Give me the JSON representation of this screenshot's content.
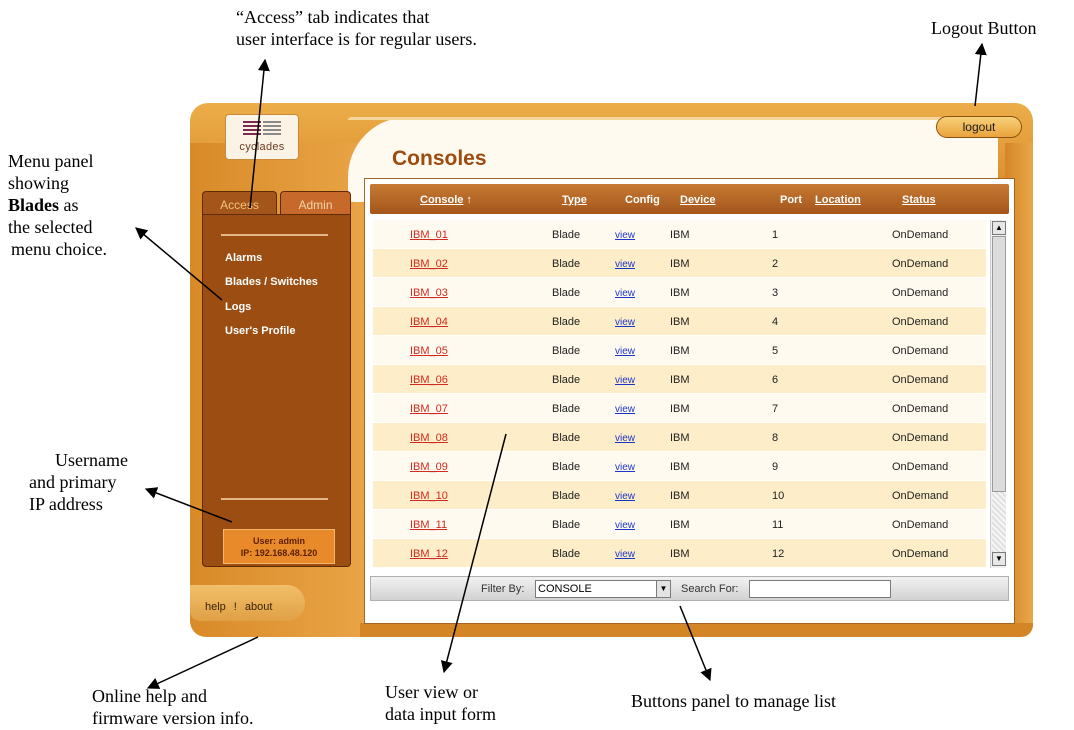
{
  "annotations": {
    "access_tab_note": [
      "“Access” tab indicates that",
      "user interface is for regular users."
    ],
    "logout_note": "Logout Button",
    "menu_note": {
      "line1": "Menu panel",
      "line2": "showing",
      "bold": "Blades",
      "line3_suffix": " as",
      "line4": "the selected",
      "line5": "menu choice."
    },
    "user_note": [
      "Username",
      "and primary",
      "IP address"
    ],
    "help_note": [
      "Online help and",
      "firmware version info."
    ],
    "form_note": [
      "User view or",
      "data input form"
    ],
    "buttons_note": "Buttons panel to manage list"
  },
  "app": {
    "logo_text": "cyclades",
    "logout_label": "logout",
    "page_title": "Consoles",
    "tabs": [
      {
        "label": "Access",
        "active": true
      },
      {
        "label": "Admin",
        "active": false
      }
    ],
    "menu_items": [
      "Alarms",
      "Blades / Switches",
      "Logs",
      "User's Profile"
    ],
    "user_line": "User: admin",
    "ip_line": "IP: 192.168.48.120",
    "help_label": "help",
    "help_separator": "!",
    "about_label": "about"
  },
  "table": {
    "columns": {
      "console": "Console",
      "type": "Type",
      "config": "Config",
      "device": "Device",
      "port": "Port",
      "location": "Location",
      "status": "Status"
    },
    "sort_icon": "↑",
    "rows": [
      {
        "console": "IBM_01",
        "type": "Blade",
        "config": "view",
        "device": "IBM",
        "port": "1",
        "location": "",
        "status": "OnDemand"
      },
      {
        "console": "IBM_02",
        "type": "Blade",
        "config": "view",
        "device": "IBM",
        "port": "2",
        "location": "",
        "status": "OnDemand"
      },
      {
        "console": "IBM_03",
        "type": "Blade",
        "config": "view",
        "device": "IBM",
        "port": "3",
        "location": "",
        "status": "OnDemand"
      },
      {
        "console": "IBM_04",
        "type": "Blade",
        "config": "view",
        "device": "IBM",
        "port": "4",
        "location": "",
        "status": "OnDemand"
      },
      {
        "console": "IBM_05",
        "type": "Blade",
        "config": "view",
        "device": "IBM",
        "port": "5",
        "location": "",
        "status": "OnDemand"
      },
      {
        "console": "IBM_06",
        "type": "Blade",
        "config": "view",
        "device": "IBM",
        "port": "6",
        "location": "",
        "status": "OnDemand"
      },
      {
        "console": "IBM_07",
        "type": "Blade",
        "config": "view",
        "device": "IBM",
        "port": "7",
        "location": "",
        "status": "OnDemand"
      },
      {
        "console": "IBM_08",
        "type": "Blade",
        "config": "view",
        "device": "IBM",
        "port": "8",
        "location": "",
        "status": "OnDemand"
      },
      {
        "console": "IBM_09",
        "type": "Blade",
        "config": "view",
        "device": "IBM",
        "port": "9",
        "location": "",
        "status": "OnDemand"
      },
      {
        "console": "IBM_10",
        "type": "Blade",
        "config": "view",
        "device": "IBM",
        "port": "10",
        "location": "",
        "status": "OnDemand"
      },
      {
        "console": "IBM_11",
        "type": "Blade",
        "config": "view",
        "device": "IBM",
        "port": "11",
        "location": "",
        "status": "OnDemand"
      },
      {
        "console": "IBM_12",
        "type": "Blade",
        "config": "view",
        "device": "IBM",
        "port": "12",
        "location": "",
        "status": "OnDemand"
      }
    ]
  },
  "filter": {
    "filter_label": "Filter By:",
    "filter_value": "CONSOLE",
    "search_label": "Search For:",
    "search_value": ""
  },
  "colors": {
    "frame_orange": "#e09a3a",
    "menu_brown": "#9c4e12",
    "title_brown": "#9c4c0e",
    "console_link": "#d22a1e",
    "config_link": "#1d35c7",
    "row_alt": "#fdedc8"
  },
  "icons": {
    "sort": "sort-up-arrow-icon",
    "scroll_up": "scroll-up-icon",
    "scroll_down": "scroll-down-icon",
    "dropdown": "chevron-down-icon"
  }
}
